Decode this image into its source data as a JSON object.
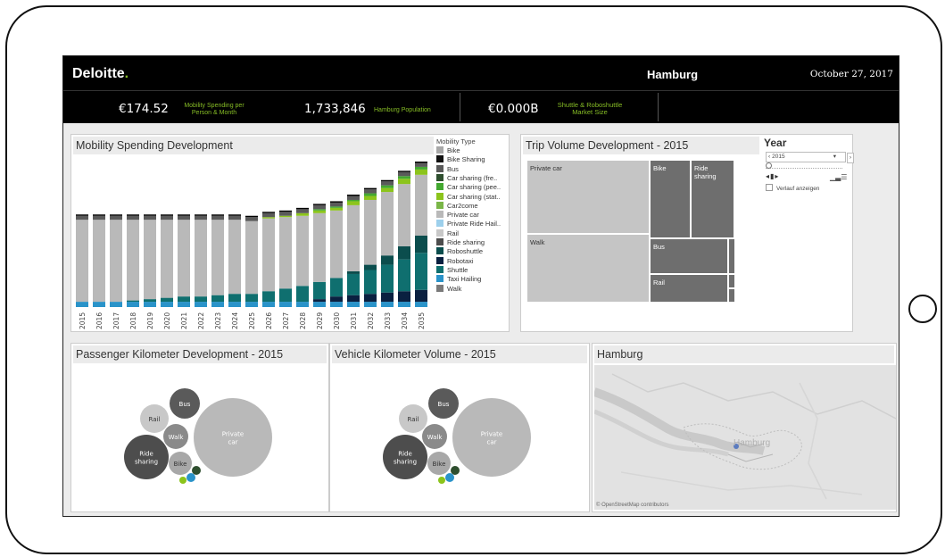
{
  "header": {
    "logo": "Deloitte",
    "logo_dot": ".",
    "city": "Hamburg",
    "date": "October 27, 2017"
  },
  "kpis": [
    {
      "value": "€174.52",
      "label": "Mobility Spending per Person & Month"
    },
    {
      "value": "1,733,846",
      "label": "Hamburg Population"
    },
    {
      "value": "€0.000B",
      "label": "Shuttle & Roboshuttle Market Size"
    }
  ],
  "colors": {
    "accent": "#86bc25",
    "bar_black": "#000000"
  },
  "spending": {
    "title": "Mobility Spending Development",
    "legend_title": "Mobility Type",
    "legend": [
      {
        "name": "Bike",
        "color": "#a8a8a8"
      },
      {
        "name": "Bike Sharing",
        "color": "#111111"
      },
      {
        "name": "Bus",
        "color": "#5a5a5a"
      },
      {
        "name": "Car sharing (fre..",
        "color": "#2f4f2f"
      },
      {
        "name": "Car sharing (pee..",
        "color": "#43a830"
      },
      {
        "name": "Car sharing (stat..",
        "color": "#8cc41c"
      },
      {
        "name": "Car2come",
        "color": "#7ab648"
      },
      {
        "name": "Private car",
        "color": "#b9b9b9"
      },
      {
        "name": "Private Ride Hail..",
        "color": "#9dd0ec"
      },
      {
        "name": "Rail",
        "color": "#c8c8c8"
      },
      {
        "name": "Ride sharing",
        "color": "#4d4d4d"
      },
      {
        "name": "Roboshuttle",
        "color": "#0b4d4d"
      },
      {
        "name": "Robotaxi",
        "color": "#0a2040"
      },
      {
        "name": "Shuttle",
        "color": "#0f6f6f"
      },
      {
        "name": "Taxi Hailing",
        "color": "#2a93c9"
      },
      {
        "name": "Walk",
        "color": "#7a7a7a"
      }
    ]
  },
  "chart_data": {
    "type": "bar",
    "stacked": true,
    "categories": [
      "2015",
      "2016",
      "2017",
      "2018",
      "2019",
      "2020",
      "2021",
      "2022",
      "2023",
      "2024",
      "2025",
      "2026",
      "2027",
      "2028",
      "2029",
      "2030",
      "2031",
      "2032",
      "2033",
      "2034",
      "2035"
    ],
    "series": [
      {
        "name": "Taxi Hailing",
        "values": [
          4,
          4,
          4,
          4,
          4,
          4,
          4,
          4,
          4,
          4,
          4,
          4,
          4,
          4,
          4,
          4,
          4,
          4,
          4,
          4,
          4
        ]
      },
      {
        "name": "Robotaxi",
        "values": [
          0,
          0,
          0,
          0,
          0,
          0,
          0,
          0,
          0,
          0,
          0,
          0,
          0,
          0,
          2,
          4,
          5,
          6,
          7,
          8,
          9
        ]
      },
      {
        "name": "Shuttle",
        "values": [
          0,
          0,
          0,
          1,
          2,
          3,
          4,
          4,
          5,
          6,
          6,
          8,
          10,
          12,
          13,
          14,
          16,
          18,
          21,
          24,
          28
        ]
      },
      {
        "name": "Roboshuttle",
        "values": [
          0,
          0,
          0,
          0,
          0,
          0,
          0,
          0,
          0,
          0,
          0,
          0,
          0,
          0,
          0,
          0,
          2,
          4,
          7,
          10,
          13
        ]
      },
      {
        "name": "Private car",
        "values": [
          62,
          62,
          62,
          61,
          60,
          59,
          58,
          58,
          57,
          56,
          55,
          55,
          54,
          53,
          52,
          51,
          50,
          49,
          48,
          47,
          46
        ]
      },
      {
        "name": "Car sharing (stat..",
        "values": [
          0,
          0,
          0,
          0,
          0,
          0,
          0,
          0,
          0,
          0,
          0,
          1,
          1,
          2,
          2,
          2,
          3,
          3,
          3,
          4,
          4
        ]
      },
      {
        "name": "Car sharing (pee..",
        "values": [
          0,
          0,
          0,
          0,
          0,
          0,
          0,
          0,
          0,
          0,
          0,
          0,
          0,
          0,
          1,
          1,
          1,
          2,
          2,
          2,
          2
        ]
      },
      {
        "name": "Bus",
        "values": [
          3,
          3,
          3,
          3,
          3,
          3,
          3,
          3,
          3,
          3,
          3,
          3,
          3,
          3,
          3,
          3,
          3,
          3,
          3,
          3,
          3
        ]
      }
    ]
  },
  "trip_volume": {
    "title": "Trip Volume Development - 2015",
    "cells": [
      {
        "label": "Private car"
      },
      {
        "label": "Walk"
      },
      {
        "label": "Bike"
      },
      {
        "label": "Ride sharing"
      },
      {
        "label": "Bus"
      },
      {
        "label": "Rail"
      }
    ]
  },
  "year_filter": {
    "title": "Year",
    "selected": "2015",
    "history_label": "Verlauf anzeigen"
  },
  "passenger_km": {
    "title": "Passenger Kilometer Development - 2015",
    "bubbles": [
      "Bus",
      "Rail",
      "Walk",
      "Private car",
      "Ride sharing",
      "Bike"
    ]
  },
  "vehicle_km": {
    "title": "Vehicle Kilometer Volume - 2015",
    "bubbles": [
      "Bus",
      "Rail",
      "Walk",
      "Private car",
      "Ride sharing",
      "Bike"
    ]
  },
  "map": {
    "title": "Hamburg",
    "label": "Hamburg",
    "attribution": "© OpenStreetMap contributors"
  }
}
